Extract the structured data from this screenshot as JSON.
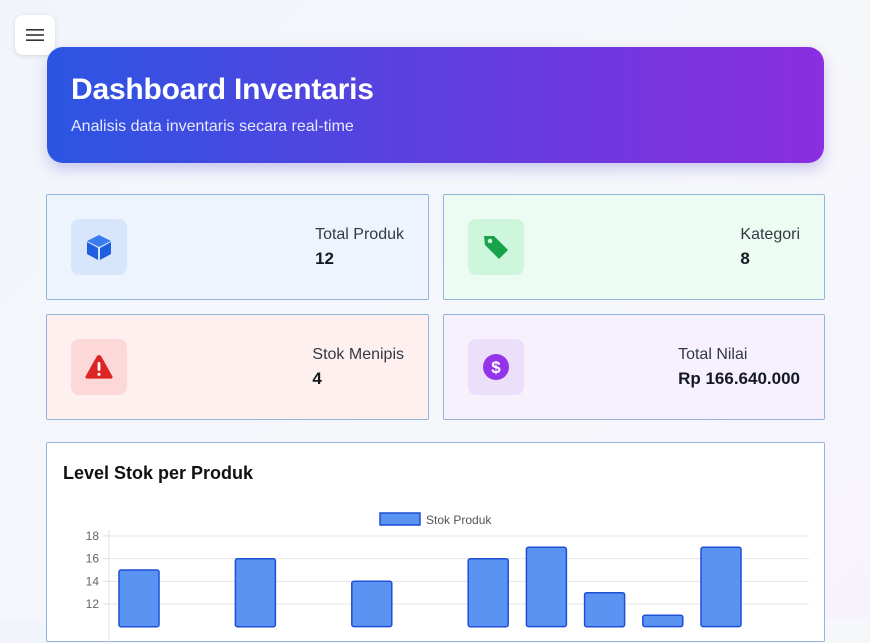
{
  "header": {
    "title": "Dashboard Inventaris",
    "subtitle": "Analisis data inventaris secara real-time"
  },
  "menu": {
    "icon": "hamburger-menu-icon"
  },
  "cards": [
    {
      "label": "Total Produk",
      "value": "12",
      "icon": "cube-icon",
      "color": "#1d5fe0"
    },
    {
      "label": "Kategori",
      "value": "8",
      "icon": "tag-icon",
      "color": "#17a34a"
    },
    {
      "label": "Stok Menipis",
      "value": "4",
      "icon": "warning-icon",
      "color": "#dc2626"
    },
    {
      "label": "Total Nilai",
      "value": "Rp 166.640.000",
      "icon": "dollar-icon",
      "color": "#9333ea"
    }
  ],
  "chart": {
    "title": "Level Stok per Produk"
  },
  "chart_data": {
    "type": "bar",
    "series": [
      {
        "name": "Stok Produk",
        "values": [
          15,
          null,
          16,
          null,
          14,
          null,
          16,
          17,
          13,
          11,
          17
        ],
        "color": "#5b93f3",
        "border": "#1e4fd6"
      }
    ],
    "yticks": [
      12,
      14,
      16,
      18
    ],
    "ylim": [
      10,
      18
    ],
    "grid": true,
    "legend": "top"
  }
}
